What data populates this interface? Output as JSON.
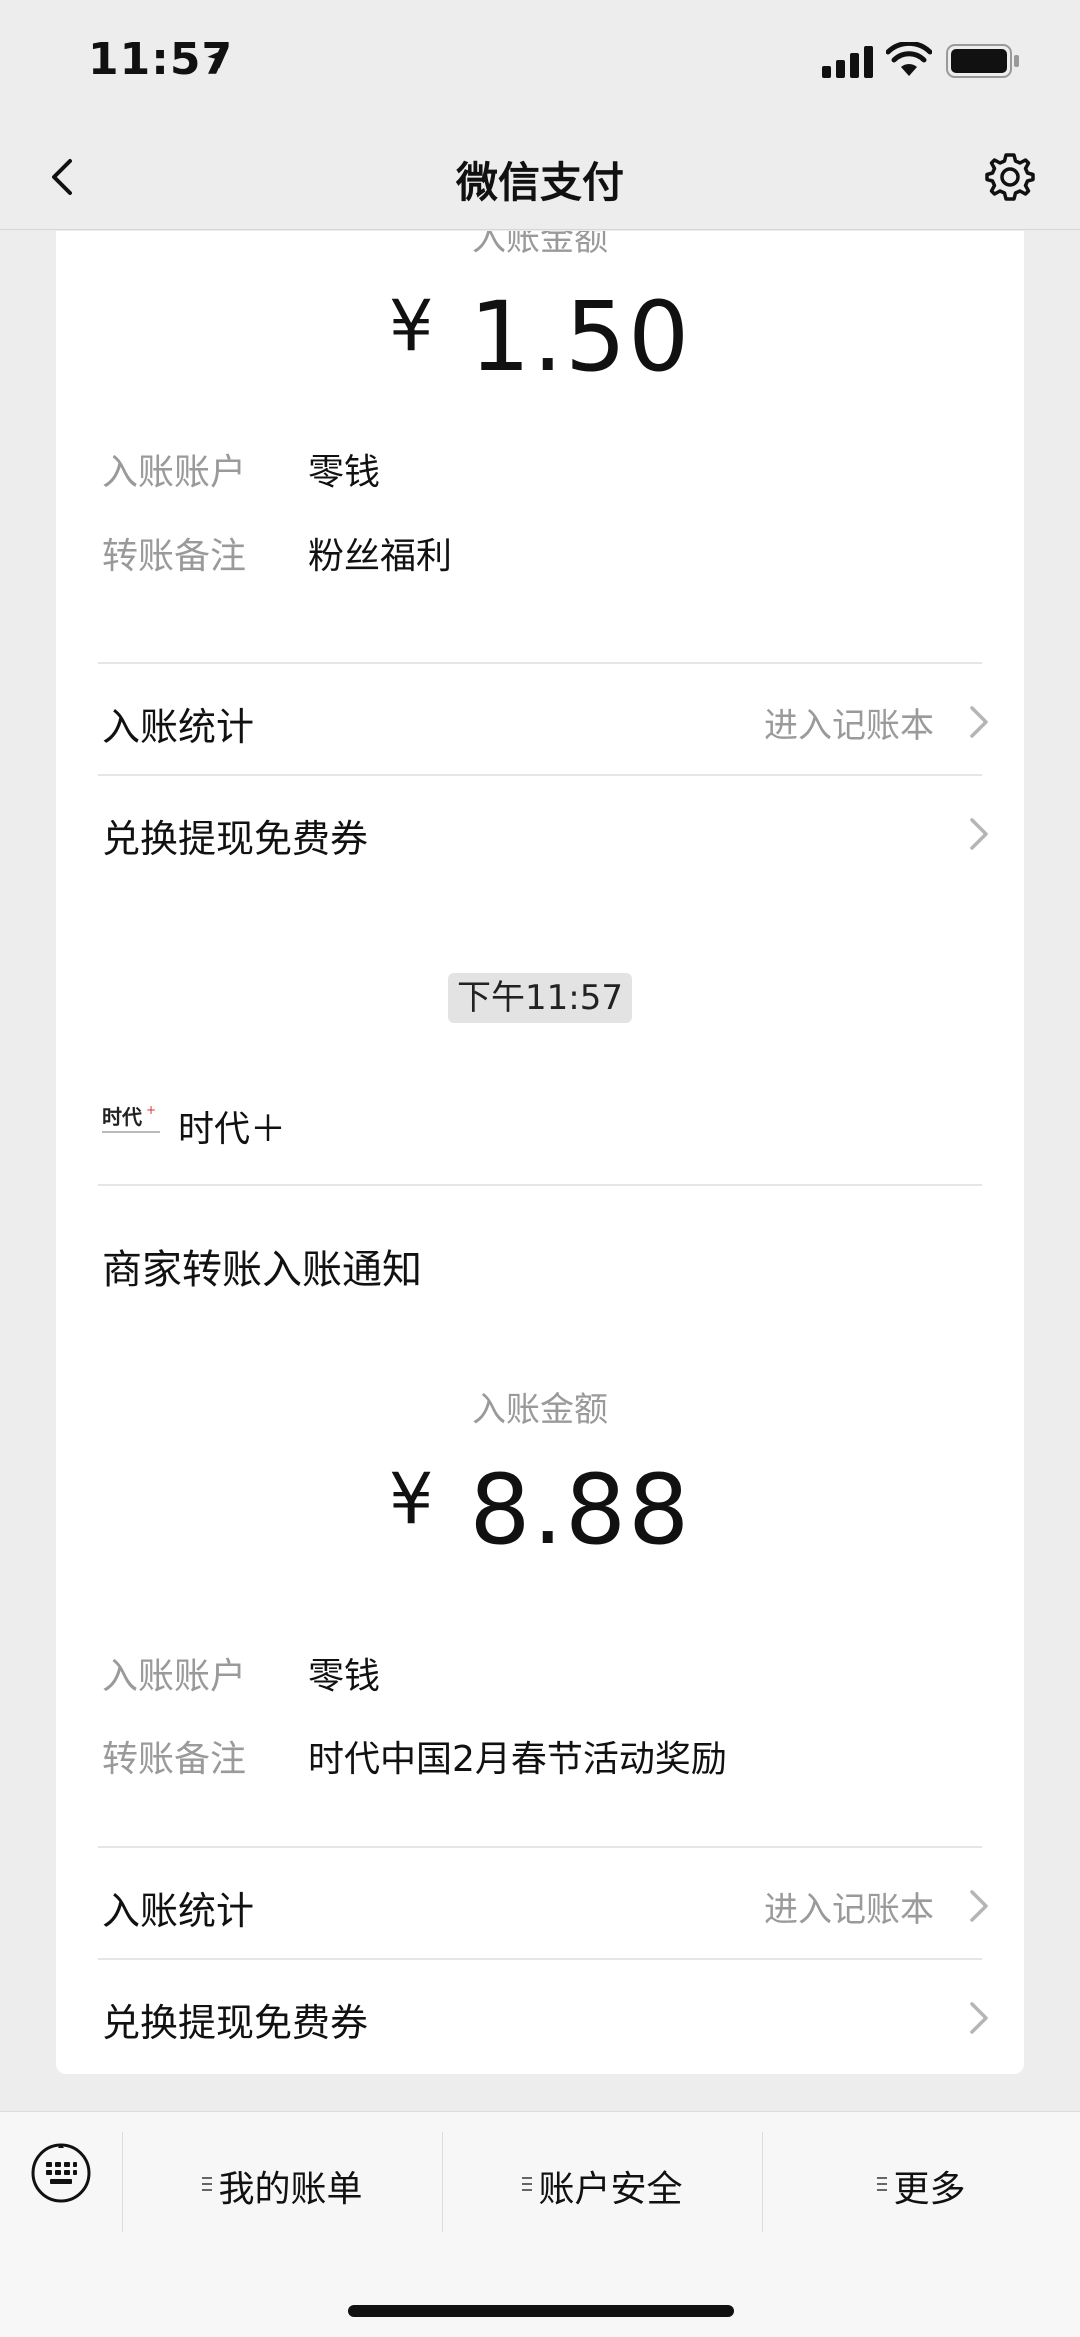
{
  "status": {
    "time": "11:57"
  },
  "nav": {
    "title": "微信支付"
  },
  "card1": {
    "amount_label": "入账金额",
    "currency": "¥",
    "amount": "1.50",
    "account_label": "入账账户",
    "account_value": "零钱",
    "remark_label": "转账备注",
    "remark_value": "粉丝福利",
    "stats_label": "入账统计",
    "stats_hint": "进入记账本",
    "coupon_label": "兑换提现免费券"
  },
  "timestamp": "下午11:57",
  "card2": {
    "brand_name": "时代＋",
    "logo_text": "时代",
    "notice_title": "商家转账入账通知",
    "amount_label": "入账金额",
    "currency": "¥",
    "amount": "8.88",
    "account_label": "入账账户",
    "account_value": "零钱",
    "remark_label": "转账备注",
    "remark_value": "时代中国2月春节活动奖励",
    "stats_label": "入账统计",
    "stats_hint": "进入记账本",
    "coupon_label": "兑换提现免费券"
  },
  "bottom_bar": {
    "items": [
      {
        "label": "我的账单"
      },
      {
        "label": "账户安全"
      },
      {
        "label": "更多"
      }
    ]
  },
  "colors": {
    "background": "#ededed",
    "card": "#ffffff",
    "muted_text": "#9a9a9a"
  }
}
